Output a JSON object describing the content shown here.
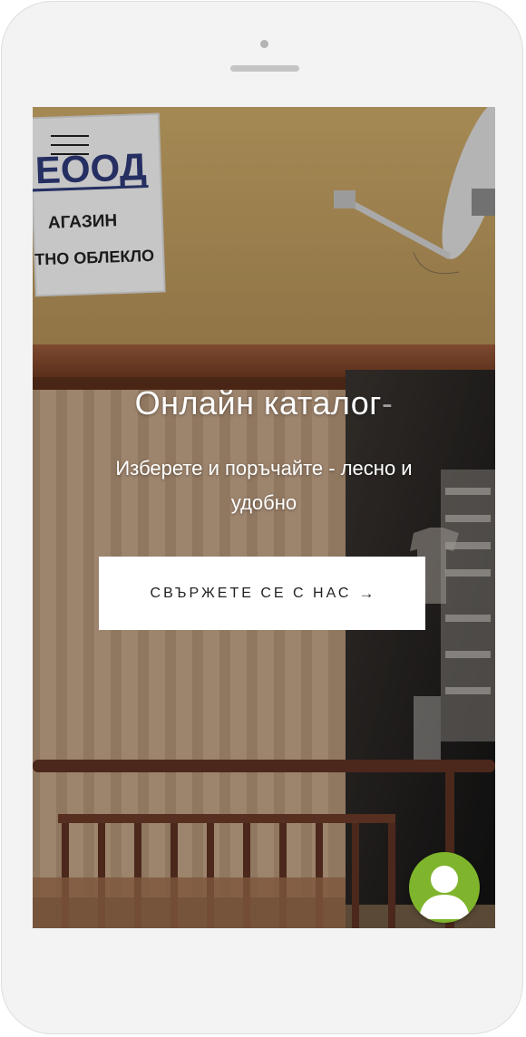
{
  "hero": {
    "title": "Онлайн каталог",
    "title_caret": "-",
    "subtitle": "Изберете и поръчайте - лесно и удобно",
    "cta_label": "СВЪРЖЕТЕ СЕ С НАС",
    "cta_arrow": "→"
  },
  "background_sign": {
    "line1": "ЕООД",
    "line2": "АГАЗИН",
    "line3": "ТНО ОБЛЕКЛО"
  },
  "icons": {
    "menu": "hamburger-menu-icon",
    "cta": "arrow-right-icon",
    "chat": "user-avatar-icon"
  },
  "colors": {
    "cta_background": "#ffffff",
    "cta_text": "#222222",
    "avatar_background": "#7fb52c",
    "hero_text": "#ffffff"
  }
}
